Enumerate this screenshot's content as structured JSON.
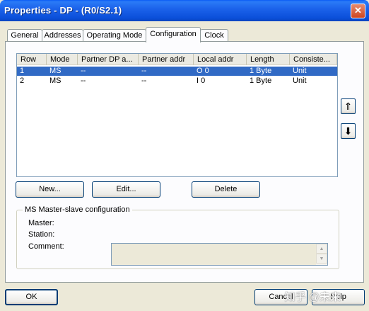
{
  "window": {
    "title": "Properties - DP - (R0/S2.1)",
    "close_glyph": "✕"
  },
  "tabs": [
    {
      "label": "General",
      "active": false
    },
    {
      "label": "Addresses",
      "active": false
    },
    {
      "label": "Operating Mode",
      "active": false
    },
    {
      "label": "Configuration",
      "active": true
    },
    {
      "label": "Clock",
      "active": false
    }
  ],
  "table": {
    "columns": [
      "Row",
      "Mode",
      "Partner DP a...",
      "Partner addr",
      "Local addr",
      "Length",
      "Consiste..."
    ],
    "rows": [
      [
        "1",
        "MS",
        "--",
        "--",
        "O 0",
        "1 Byte",
        "Unit"
      ],
      [
        "2",
        "MS",
        "--",
        "--",
        "I 0",
        "1 Byte",
        "Unit"
      ]
    ],
    "selected_row": 0
  },
  "move_up_glyph": "⇑",
  "move_down_glyph": "⬇",
  "buttons": {
    "new": "New...",
    "edit": "Edit...",
    "delete": "Delete",
    "ok": "OK",
    "cancel": "Cancel",
    "help": "Help"
  },
  "ms_group": {
    "legend": "MS Master-slave configuration",
    "master_label": "Master:",
    "station_label": "Station:",
    "comment_label": "Comment:",
    "comment_value": "",
    "scroll_up": "▲",
    "scroll_down": "▼"
  },
  "watermark": "知乎 @未来"
}
